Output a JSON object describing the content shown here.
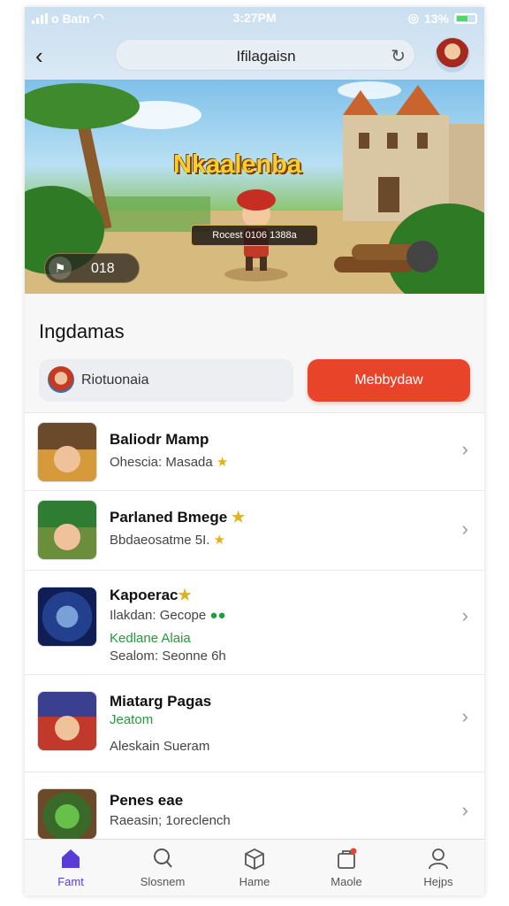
{
  "status_bar": {
    "carrier": "o Batn",
    "time": "3:27PM",
    "battery": "13%"
  },
  "nav": {
    "url": "Ifilagaisn"
  },
  "hero": {
    "title": "Nkaalenba",
    "scorebar": "Rocest 0106 1388a",
    "badge_value": "018"
  },
  "section": {
    "title": "Ingdamas"
  },
  "profile": {
    "name": "Riotuonaia"
  },
  "primary_button": {
    "label": "Mebbydaw"
  },
  "games": [
    {
      "title": "Baliodr Mamp",
      "line1": "Ohescia: Masada",
      "star1": "★"
    },
    {
      "title": "Parlaned Bmege",
      "title_star": "★",
      "line1": "Bbdaeosatme 5I.",
      "star1": "★"
    },
    {
      "title": "Kapoerac",
      "title_star": "★",
      "line1": "Ilakdan: Gecope",
      "green": "Kedlane Alaia",
      "line2": "Sealom: Seonne 6h"
    },
    {
      "title": "Miatarg Pagas",
      "green": "Jeatom",
      "line1": "Aleskain Sueram"
    },
    {
      "title": "Penes eae",
      "line1": "Raeasin; 1oreclench"
    }
  ],
  "tabs": [
    {
      "label": "Famt",
      "icon": "home-icon",
      "active": true
    },
    {
      "label": "Slosnem",
      "icon": "search-icon",
      "active": false
    },
    {
      "label": "Hame",
      "icon": "box-icon",
      "active": false
    },
    {
      "label": "Maole",
      "icon": "bag-icon",
      "active": false
    },
    {
      "label": "Hejps",
      "icon": "user-icon",
      "active": false
    }
  ],
  "colors": {
    "accent": "#e8442a",
    "tab_active": "#5b3bd6",
    "price_green": "#1e9e3a",
    "star": "#e0b21c"
  }
}
